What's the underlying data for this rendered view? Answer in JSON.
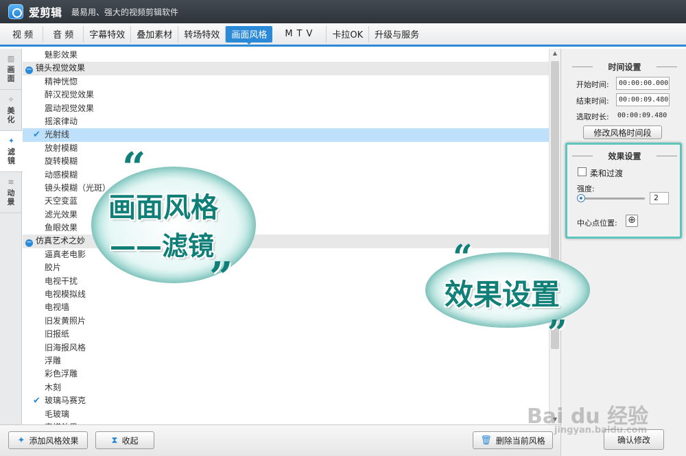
{
  "app": {
    "title": "爱剪辑",
    "slogan": "最易用、强大的视频剪辑软件"
  },
  "menu": [
    {
      "label": "视 频"
    },
    {
      "label": "音 频"
    },
    {
      "label": "字幕特效"
    },
    {
      "label": "叠加素材"
    },
    {
      "label": "转场特效"
    },
    {
      "label": "画面风格",
      "active": true
    },
    {
      "label": "MTV"
    },
    {
      "label": "卡拉OK"
    },
    {
      "label": "升级与服务"
    }
  ],
  "side_tabs": [
    {
      "label": "画面",
      "icon": "film-strip-icon"
    },
    {
      "label": "美化",
      "icon": "magic-wand-icon"
    },
    {
      "label": "滤镜",
      "icon": "sparkle-wand-icon",
      "active": true
    },
    {
      "label": "动景",
      "icon": "wave-icon"
    }
  ],
  "effects_list": [
    {
      "type": "item",
      "label": "魅影效果"
    },
    {
      "type": "group",
      "label": "镜头视觉效果"
    },
    {
      "type": "item",
      "label": "精神恍惚"
    },
    {
      "type": "item",
      "label": "醉汉视觉效果"
    },
    {
      "type": "item",
      "label": "震动视觉效果"
    },
    {
      "type": "item",
      "label": "摇滚律动"
    },
    {
      "type": "item",
      "label": "光射线",
      "checked": true,
      "selected": true
    },
    {
      "type": "item",
      "label": "放射模糊"
    },
    {
      "type": "item",
      "label": "旋转模糊"
    },
    {
      "type": "item",
      "label": "动感模糊"
    },
    {
      "type": "item",
      "label": "镜头模糊（光斑）"
    },
    {
      "type": "item",
      "label": "天空变蓝"
    },
    {
      "type": "item",
      "label": "滤光效果"
    },
    {
      "type": "item",
      "label": "鱼眼效果"
    },
    {
      "type": "group",
      "label": "仿真艺术之妙"
    },
    {
      "type": "item",
      "label": "逼真老电影"
    },
    {
      "type": "item",
      "label": "胶片"
    },
    {
      "type": "item",
      "label": "电视干扰"
    },
    {
      "type": "item",
      "label": "电视模拟线"
    },
    {
      "type": "item",
      "label": "电视墙"
    },
    {
      "type": "item",
      "label": "旧发黄照片"
    },
    {
      "type": "item",
      "label": "旧报纸"
    },
    {
      "type": "item",
      "label": "旧海报风格"
    },
    {
      "type": "item",
      "label": "浮雕"
    },
    {
      "type": "item",
      "label": "彩色浮雕"
    },
    {
      "type": "item",
      "label": "木刻"
    },
    {
      "type": "item",
      "label": "玻璃马赛克",
      "checked": true
    },
    {
      "type": "item",
      "label": "毛玻璃"
    },
    {
      "type": "item",
      "label": "素描效果"
    }
  ],
  "time_settings": {
    "title": "时间设置",
    "start_label": "开始时间:",
    "start_value": "00:00:00.000",
    "end_label": "结束时间:",
    "end_value": "00:00:09.480",
    "duration_label": "选取时长:",
    "duration_value": "00:00:09.480",
    "modify_button": "修改风格时间段"
  },
  "effect_settings": {
    "title": "效果设置",
    "smooth_label": "柔和过渡",
    "smooth_checked": false,
    "strength_label": "强度:",
    "strength_value": "2",
    "center_label": "中心点位置:"
  },
  "bottom": {
    "add_button": "添加风格效果",
    "collapse_button": "收起",
    "delete_button": "删除当前风格",
    "confirm_button": "确认修改"
  },
  "overlays": {
    "bubble1_line1": "画面风格",
    "bubble1_line2": "——滤镜",
    "bubble2": "效果设置",
    "watermark_main": "Bai du 经验",
    "watermark_sub": "jingyan.baidu.com"
  },
  "colors": {
    "accent": "#2b8ad8",
    "highlight": "#5cc6bd",
    "selected_row": "#bfe0fa"
  }
}
